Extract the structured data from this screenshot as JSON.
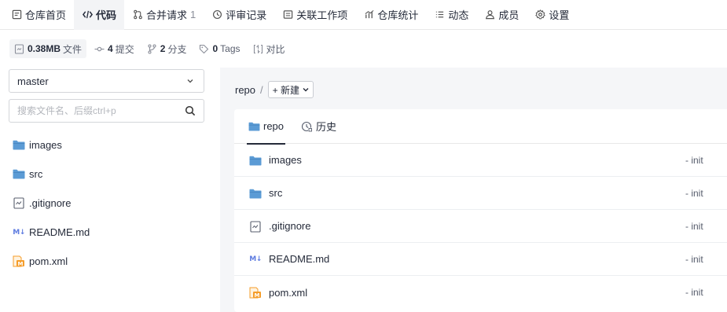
{
  "nav": {
    "tabs": [
      {
        "label": "仓库首页",
        "icon": "book-icon"
      },
      {
        "label": "代码",
        "icon": "code-icon",
        "active": true
      },
      {
        "label": "合并请求",
        "icon": "merge-icon",
        "count": "1"
      },
      {
        "label": "评审记录",
        "icon": "review-icon"
      },
      {
        "label": "关联工作项",
        "icon": "workitem-icon"
      },
      {
        "label": "仓库统计",
        "icon": "chart-icon"
      },
      {
        "label": "动态",
        "icon": "activity-icon"
      },
      {
        "label": "成员",
        "icon": "user-icon"
      },
      {
        "label": "设置",
        "icon": "gear-icon"
      }
    ]
  },
  "stats": {
    "size_value": "0.38MB",
    "size_label": "文件",
    "commits_value": "4",
    "commits_label": "提交",
    "branches_value": "2",
    "branches_label": "分支",
    "tags_value": "0",
    "tags_label": "Tags",
    "compare_label": "对比"
  },
  "sidebar": {
    "branch": "master",
    "search_placeholder": "搜索文件名、后缀ctrl+p",
    "tree": [
      {
        "name": "images",
        "type": "folder"
      },
      {
        "name": "src",
        "type": "folder"
      },
      {
        "name": ".gitignore",
        "type": "file"
      },
      {
        "name": "README.md",
        "type": "markdown"
      },
      {
        "name": "pom.xml",
        "type": "maven"
      }
    ]
  },
  "main": {
    "breadcrumb_root": "repo",
    "breadcrumb_sep": "/",
    "new_label": "+ 新建",
    "tabs": {
      "repo": "repo",
      "history": "历史"
    },
    "files": [
      {
        "name": "images",
        "type": "folder",
        "commit": "- init"
      },
      {
        "name": "src",
        "type": "folder",
        "commit": "- init"
      },
      {
        "name": ".gitignore",
        "type": "file",
        "commit": "- init"
      },
      {
        "name": "README.md",
        "type": "markdown",
        "commit": "- init"
      },
      {
        "name": "pom.xml",
        "type": "maven",
        "commit": "- init"
      }
    ]
  },
  "colors": {
    "folder": "#5b9bd5",
    "accent": "#5e7ce0",
    "maven": "#f59d2a"
  }
}
